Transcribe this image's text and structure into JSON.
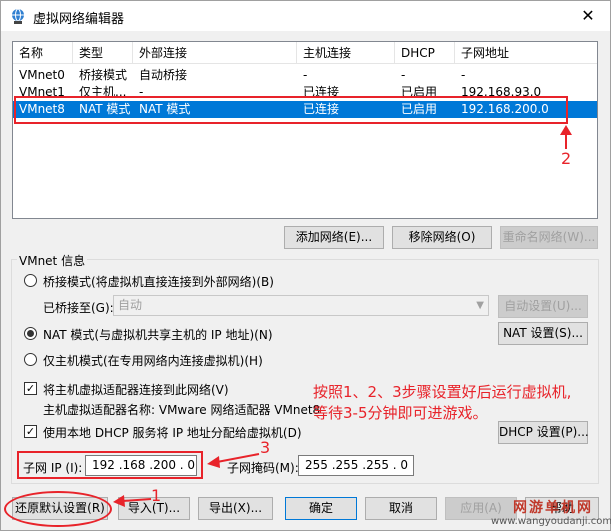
{
  "window": {
    "title": "虚拟网络编辑器",
    "close_glyph": "✕"
  },
  "table": {
    "columns": [
      "名称",
      "类型",
      "外部连接",
      "主机连接",
      "DHCP",
      "子网地址"
    ],
    "rows": [
      [
        "VMnet0",
        "桥接模式",
        "自动桥接",
        "-",
        "-",
        "-"
      ],
      [
        "VMnet1",
        "仅主机...",
        "-",
        "已连接",
        "已启用",
        "192.168.93.0"
      ],
      [
        "VMnet8",
        "NAT 模式",
        "NAT 模式",
        "已连接",
        "已启用",
        "192.168.200.0"
      ]
    ]
  },
  "net_buttons": {
    "add": "添加网络(E)...",
    "remove": "移除网络(O)",
    "rename": "重命名网络(W)..."
  },
  "vmnet_info": {
    "title": "VMnet 信息",
    "bridged_radio": "桥接模式(将虚拟机直接连接到外部网络)(B)",
    "bridged_to_label": "已桥接至(G):",
    "bridged_to_value": "自动",
    "auto_settings": "自动设置(U)...",
    "nat_radio": "NAT 模式(与虚拟机共享主机的 IP 地址)(N)",
    "nat_settings": "NAT 设置(S)...",
    "hostonly_radio": "仅主机模式(在专用网络内连接虚拟机)(H)",
    "connect_adapter_check": "将主机虚拟适配器连接到此网络(V)",
    "adapter_name": "主机虚拟适配器名称: VMware 网络适配器 VMnet8",
    "dhcp_check": "使用本地 DHCP 服务将 IP 地址分配给虚拟机(D)",
    "dhcp_settings": "DHCP 设置(P)...",
    "subnet_ip_label": "子网 IP (I):",
    "subnet_ip": "192 .168 .200 . 0",
    "subnet_mask_label": "子网掩码(M):",
    "subnet_mask": "255 .255 .255 . 0"
  },
  "bottom_buttons": {
    "restore": "还原默认设置(R)",
    "import": "导入(T)...",
    "export": "导出(X)...",
    "ok": "确定",
    "cancel": "取消",
    "apply": "应用(A)",
    "help": "帮助"
  },
  "annotation": {
    "text_line1": "按照1、2、3步骤设置好后运行虚拟机,",
    "text_line2": "等待3-5分钟即可进游戏。",
    "n1": "1",
    "n2": "2",
    "n3": "3"
  },
  "watermark": {
    "line1": "网游单机网",
    "line2": "www.wangyoudanji.com"
  },
  "colors": {
    "accent": "#0078d7",
    "annotation_red": "#e8232a"
  }
}
